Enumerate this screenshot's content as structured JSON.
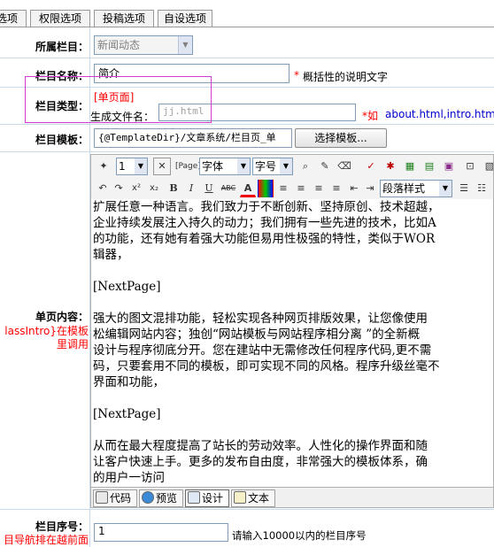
{
  "tabs": [
    "选项",
    "权限选项",
    "投稿选项",
    "自设选项"
  ],
  "fields": {
    "parent": {
      "label": "所属栏目：",
      "value": "新闻动态"
    },
    "name": {
      "label": "栏目名称：",
      "value": "简介",
      "star": "*",
      "hint": "概括性的说明文字"
    },
    "type": {
      "label": "栏目类型：",
      "value": "[单页面]",
      "filename_label": "生成文件名：",
      "filename_placeholder": "jj.html",
      "star": "*如",
      "examples": "about.html,intro.html,",
      "color": "#ff0000"
    },
    "template": {
      "label": "栏目模板：",
      "value": "{@TemplateDir}/文章系统/栏目页_单",
      "button": "选择模板..."
    },
    "content": {
      "label": "单页内容：",
      "side_note_1": "lassIntro}在模板",
      "side_note_2": "里调用"
    },
    "order": {
      "label": "栏目序号：",
      "note": "目导航排在越前面",
      "value": "1",
      "hint": "请输入10000以内的栏目序号"
    }
  },
  "editor": {
    "toolbar1": {
      "size_value": "1",
      "font": "字体",
      "fontsize": "字号",
      "page": "[Page]"
    },
    "toolbar2": {
      "paragraph": "段落样式"
    },
    "lines": [
      "扩展任意一种语言。我们致力于不断创新、坚持原创、技术超越，",
      "企业持续发展注入持久的动力；我们拥有一些先进的技术，比如A",
      "的功能，还有她有着强大功能但易用性极强的特性，类似于WOR",
      "辑器，",
      "",
      "[NextPage]",
      "",
      "强大的图文混排功能，轻松实现各种网页排版效果，让您像使用",
      "松编辑网站内容；独创“网站模板与网站程序相分离 ”的全新概",
      "设计与程序彻底分开。您在建站中无需修改任何程序代码,更不需",
      "码，只要套用不同的模板，即可实现不同的风格。程序升级丝毫不",
      "界面和功能，",
      "",
      "[NextPage]",
      "",
      "从而在最大程度提高了站长的劳动效率。人性化的操作界面和随",
      "让客户快速上手。更多的发布自由度，非常强大的模板体系，确",
      "的用户一访问"
    ],
    "bottom_tabs": [
      "代码",
      "预览",
      "设计",
      "文本"
    ]
  },
  "colors": {
    "accent_red": "#ff0000",
    "link_blue": "#0000cc",
    "highlight": "#d23ad2"
  }
}
